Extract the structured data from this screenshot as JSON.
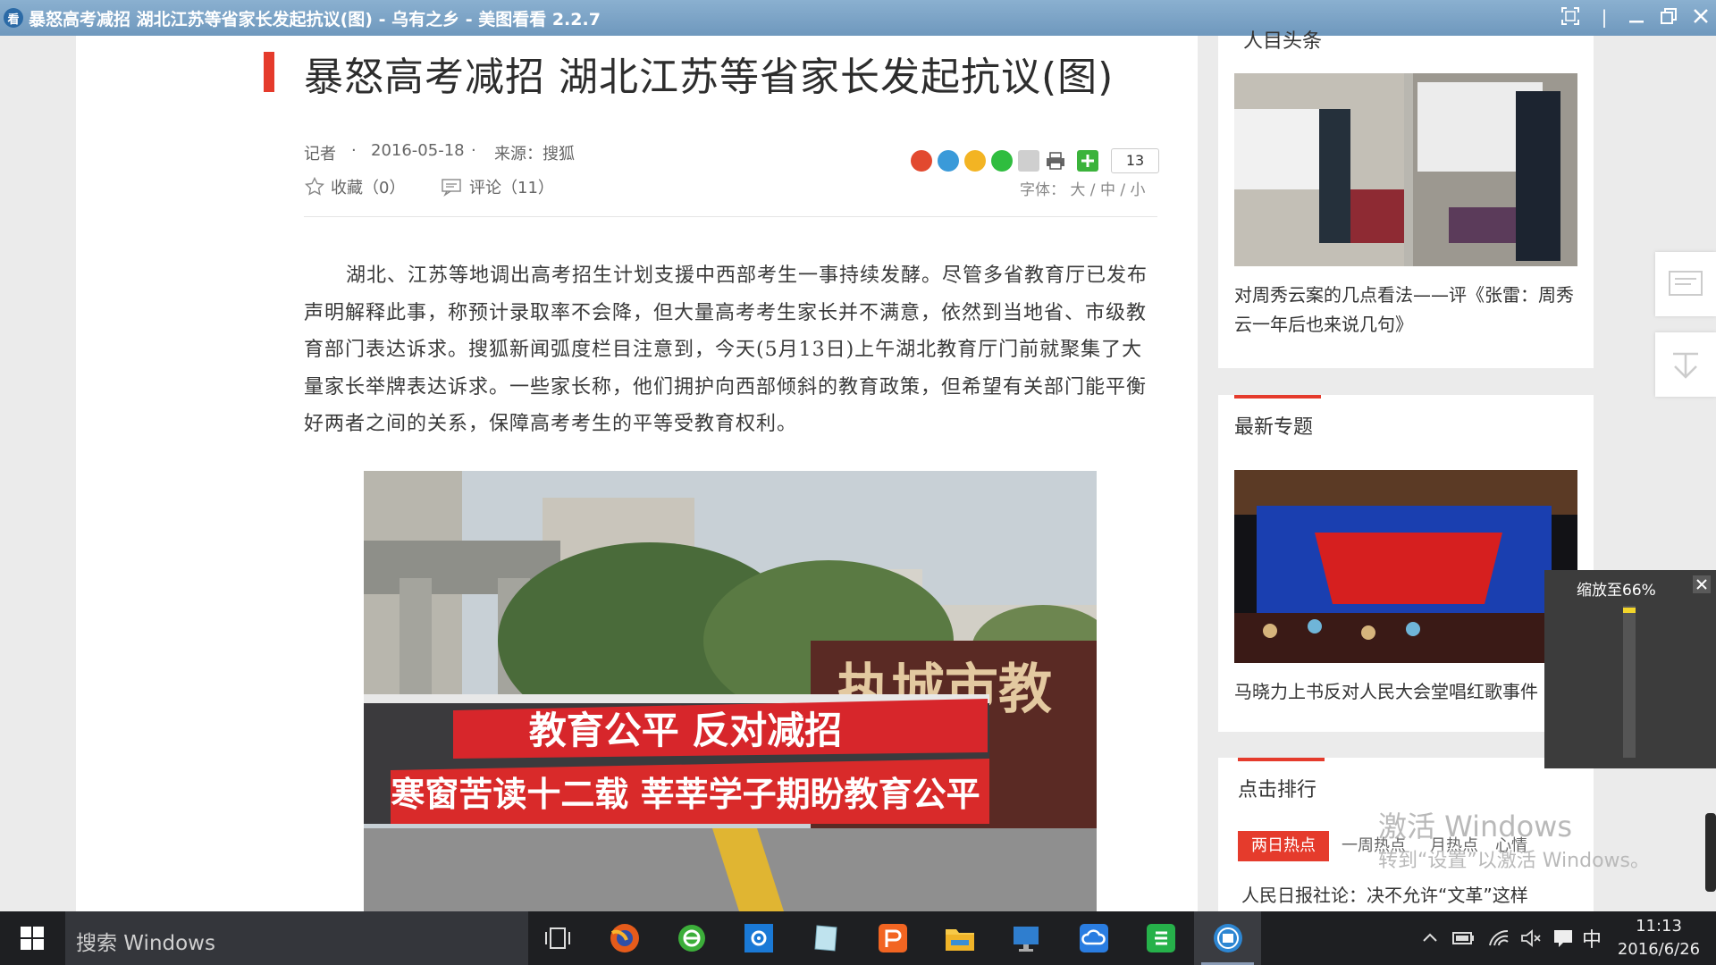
{
  "window": {
    "icon_glyph": "看",
    "title": "暴怒高考减招 湖北江苏等省家长发起抗议(图) - 乌有之乡 - 美图看看 2.2.7",
    "controls": [
      "fullscreen-icon",
      "minimize-icon",
      "restore-icon",
      "close-icon"
    ]
  },
  "article": {
    "headline": "暴怒高考减招 湖北江苏等省家长发起抗议(图)",
    "reporter_label": "记者",
    "dot": "·",
    "date": "2016-05-18",
    "source": "来源：搜狐",
    "favorite": "收藏（0）",
    "comment": "评论（11）",
    "share_count": "13",
    "font_size": "字体： 大 / 中 / 小",
    "body": "湖北、江苏等地调出高考招生计划支援中西部考生一事持续发酵。尽管多省教育厅已发布声明解释此事，称预计录取率不会降，但大量高考考生家长并不满意，依然到当地省、市级教育部门表达诉求。搜狐新闻弧度栏目注意到，今天(5月13日)上午湖北教育厅门前就聚集了大量家长举牌表达诉求。一些家长称，他们拥护向西部倾斜的教育政策，但希望有关部门能平衡好两者之间的关系，保障高考考生的平等受教育权利。",
    "photo": {
      "banner_top": "教育公平 反对减招",
      "banner_bottom": "寒窗苦读十二载 莘莘学子期盼教育公平",
      "building_sign": "执城市教"
    }
  },
  "sidebar": {
    "top_partial_heading": "人目头条",
    "story1_title": "对周秀云案的几点看法——评《张雷：周秀云一年后也来说几句》",
    "section2_heading": "最新专题",
    "story2_title": "马晓力上书反对人民大会堂唱红歌事件",
    "section3_heading": "点击排行",
    "tabs": [
      "两日热点",
      "一周热点",
      "月热点",
      "心情"
    ],
    "rank1": "人民日报社论：决不允许“文革”这样"
  },
  "zoom_popup": {
    "label": "缩放至66%"
  },
  "activation": {
    "line1": "激活 Windows",
    "line2": "转到“设置”以激活 Windows。"
  },
  "taskbar": {
    "search_placeholder": "搜索 Windows",
    "time": "11:13",
    "date": "2016/6/26",
    "ime": "中",
    "apps": [
      "task-view-icon",
      "firefox-icon",
      "ie-browser-icon",
      "settings-icon",
      "notebook-icon",
      "wps-presentation-icon",
      "file-explorer-icon",
      "remote-desktop-icon",
      "cloud-drive-icon",
      "wps-spreadsheet-icon",
      "image-viewer-icon"
    ]
  },
  "colors": {
    "accent_red": "#e53b2c",
    "titlebar": "#7aa3c6",
    "taskbar": "#1e1f22"
  }
}
